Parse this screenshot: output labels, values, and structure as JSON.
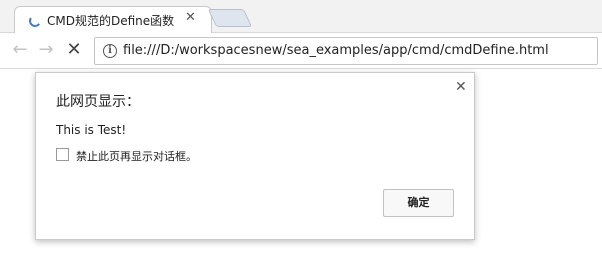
{
  "browser": {
    "tab": {
      "title": "CMD规范的Define函数",
      "close_glyph": "✕",
      "favicon_icon": "loading-spinner-icon"
    },
    "toolbar": {
      "back_glyph": "←",
      "forward_glyph": "→",
      "stop_glyph": "✕",
      "info_glyph": "i",
      "url": "file:///D:/workspacesnew/sea_examples/app/cmd/cmdDefine.html"
    }
  },
  "dialog": {
    "title": "此网页显示：",
    "close_glyph": "✕",
    "message": "This is Test!",
    "checkbox_label": "禁止此页再显示对话框。",
    "checkbox_checked": false,
    "ok_label": "确定"
  },
  "colors": {
    "spinner": "#4a78c8",
    "tabstrip_bg": "#f2f2f2"
  }
}
